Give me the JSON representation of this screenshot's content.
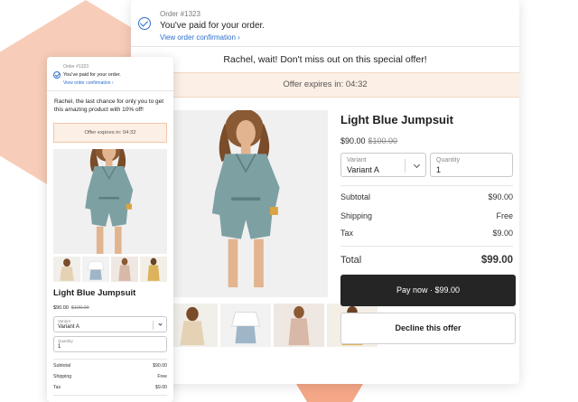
{
  "order": {
    "number": "Order #1323",
    "paid_message": "You've paid for your order.",
    "view_link": "View order confirmation ›"
  },
  "offer": {
    "headline": "Rachel, wait! Don't miss out on this special offer!",
    "headline_mobile": "Rachel, the last chance for only you to get this amazing product with 10% off!",
    "expires_label": "Offer expires in: 04:32"
  },
  "product": {
    "title": "Light Blue Jumpsuit",
    "price": "$90.00",
    "compare_price": "$100.00",
    "variant_label": "Variant",
    "variant_value": "Variant A",
    "quantity_label": "Quantity",
    "quantity_value": "1"
  },
  "summary": {
    "subtotal_label": "Subtotal",
    "subtotal_value": "$90.00",
    "shipping_label": "Shipping",
    "shipping_value": "Free",
    "tax_label": "Tax",
    "tax_value": "$9.00",
    "total_label": "Total",
    "total_value": "$99.00"
  },
  "actions": {
    "pay_label": "Pay now · $99.00",
    "decline_label": "Decline this offer"
  },
  "colors": {
    "accent": "#2c6ecb",
    "banner_bg": "#fcefe5",
    "pay_button": "#252525",
    "decor_hex": "#f7cdb9"
  }
}
